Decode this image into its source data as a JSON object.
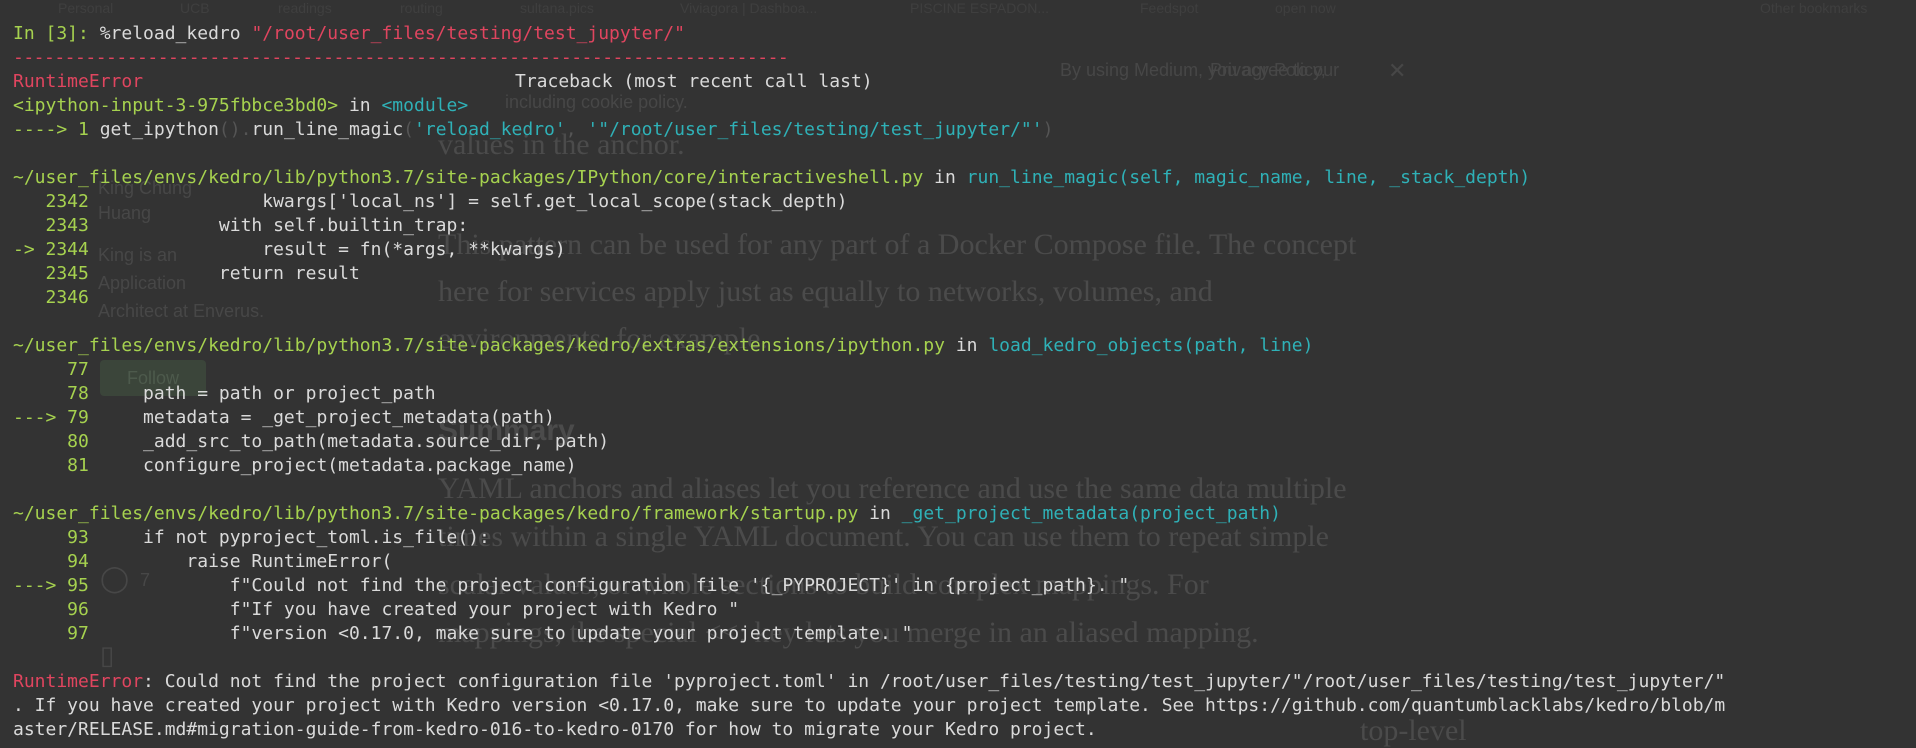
{
  "background_page": {
    "bookmarks": [
      "Personal",
      "UCB",
      "readings",
      "routing",
      "sultana.pics",
      "Viviagora | Dashboa...",
      "PISCINE ESPADON...",
      "Feedspot",
      "open now",
      "Other bookmarks"
    ],
    "cookie_notice": [
      "By using Medium, you agree to our",
      "Privacy Policy,",
      "including cookie policy."
    ],
    "sidebar": [
      "King Chung",
      "Huang",
      "King is an",
      "Application",
      "Architect at Enverus."
    ],
    "follow_label": "Follow",
    "article_lines": [
      "values in the anchor.",
      "This pattern can be used for any part of a Docker Compose file. The concept",
      "here for services apply just as equally to networks, volumes, and",
      "environments, for example.",
      "Summary",
      "YAML anchors and aliases let you reference and use the same data multiple",
      "times within a single YAML document. You can use them to repeat simple",
      "scalar values, or whole sections to build complex mappings. For",
      "mappings, the special <<: key lets you merge in an aliased mapping.",
      "top-level"
    ],
    "clap_count": "7"
  },
  "terminal": {
    "prompt": "In [3]:",
    "command": "%reload_kedro",
    "command_arg": "\"/root/user_files/testing/test_jupyter/\"",
    "separator": "---------------------------------------------------------------------------",
    "error_name": "RuntimeError",
    "traceback_header": "Traceback (most recent call last)",
    "frames": [
      {
        "location": "<ipython-input-3-975fbbce3bd0>",
        "in_word": " in ",
        "func": "<module>",
        "lines": [
          {
            "marker": "----> 1 ",
            "code_parts": [
              {
                "t": "get_ipython",
                "c": "w"
              },
              {
                "t": "()",
                "c": "dim"
              },
              {
                "t": ".",
                "c": "dim"
              },
              {
                "t": "run_line_magic",
                "c": "w"
              },
              {
                "t": "(",
                "c": "dim"
              },
              {
                "t": "'reload_kedro'",
                "c": "cy"
              },
              {
                "t": ", ",
                "c": "dim"
              },
              {
                "t": "'\"/root/user_files/testing/test_jupyter/\"'",
                "c": "cy"
              },
              {
                "t": ")",
                "c": "dim"
              }
            ]
          }
        ]
      },
      {
        "location": "~/user_files/envs/kedro/lib/python3.7/site-packages/IPython/core/interactiveshell.py",
        "in_word": " in ",
        "func": "run_line_magic(self, magic_name, line, _stack_depth)",
        "lines": [
          {
            "marker": "   2342 ",
            "code": "               kwargs['local_ns'] = self.get_local_scope(stack_depth)"
          },
          {
            "marker": "   2343 ",
            "code": "           with self.builtin_trap:"
          },
          {
            "marker": "-> 2344 ",
            "code": "               result = fn(*args, **kwargs)"
          },
          {
            "marker": "   2345 ",
            "code": "           return result"
          },
          {
            "marker": "   2346 ",
            "code": ""
          }
        ]
      },
      {
        "location": "~/user_files/envs/kedro/lib/python3.7/site-packages/kedro/extras/extensions/ipython.py",
        "in_word": " in ",
        "func": "load_kedro_objects(path, line)",
        "lines": [
          {
            "marker": "     77 ",
            "code": ""
          },
          {
            "marker": "     78 ",
            "code": "    path = path or project_path"
          },
          {
            "marker": "---> 79 ",
            "code": "    metadata = _get_project_metadata(path)"
          },
          {
            "marker": "     80 ",
            "code": "    _add_src_to_path(metadata.source_dir, path)"
          },
          {
            "marker": "     81 ",
            "code": "    configure_project(metadata.package_name)"
          }
        ]
      },
      {
        "location": "~/user_files/envs/kedro/lib/python3.7/site-packages/kedro/framework/startup.py",
        "in_word": " in ",
        "func": "_get_project_metadata(project_path)",
        "lines": [
          {
            "marker": "     93 ",
            "code": "    if not pyproject_toml.is_file():"
          },
          {
            "marker": "     94 ",
            "code": "        raise RuntimeError("
          },
          {
            "marker": "---> 95 ",
            "code": "            f\"Could not find the project configuration file '{_PYPROJECT}' in {project_path}. \""
          },
          {
            "marker": "     96 ",
            "code": "            f\"If you have created your project with Kedro \""
          },
          {
            "marker": "     97 ",
            "code": "            f\"version <0.17.0, make sure to update your project template. \""
          }
        ]
      }
    ],
    "final_error": {
      "name": "RuntimeError",
      "line1": ": Could not find the project configuration file 'pyproject.toml' in /root/user_files/testing/test_jupyter/\"/root/user_files/testing/test_jupyter/\"",
      "line2": ". If you have created your project with Kedro version <0.17.0, make sure to update your project template. See https://github.com/quantumblacklabs/kedro/blob/m",
      "line3": "aster/RELEASE.md#migration-guide-from-kedro-016-to-kedro-0170 for how to migrate your Kedro project."
    }
  }
}
